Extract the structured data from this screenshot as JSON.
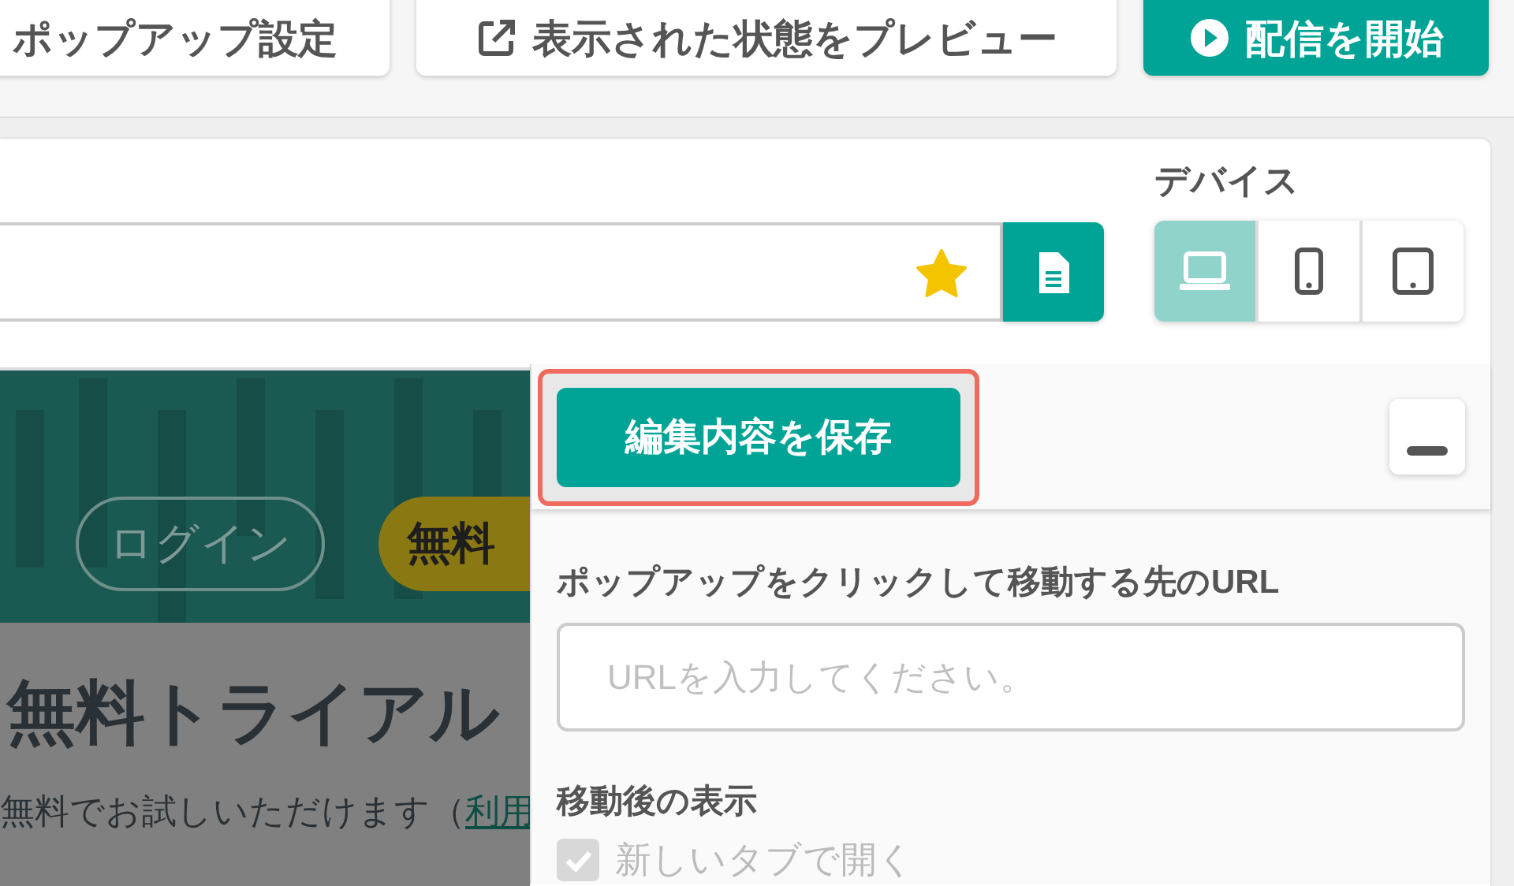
{
  "toolbar": {
    "buttons": [
      {
        "label": "ポップアップ設定",
        "kind": "plain"
      },
      {
        "label": "表示された状態をプレビュー",
        "kind": "preview"
      },
      {
        "label": "配信を開始",
        "kind": "primary"
      }
    ]
  },
  "url_bar": {
    "starred": true
  },
  "devices": {
    "label": "デバイス",
    "items": [
      {
        "kind": "laptop",
        "selected": true
      },
      {
        "kind": "phone",
        "selected": false
      },
      {
        "kind": "tablet",
        "selected": false
      }
    ]
  },
  "preview": {
    "login_button": "ログイン",
    "trial_button": "無料",
    "heading": "無料トライアル",
    "text": "無料でお試しいただけます（",
    "link": "利用"
  },
  "editor": {
    "save_button": "編集内容を保存",
    "save_highlighted": true,
    "url_label": "ポップアップをクリックして移動する先のURL",
    "url_placeholder": "URLを入力してください。",
    "after_label": "移動後の表示",
    "new_tab": {
      "label": "新しいタブで開く",
      "checked": true,
      "disabled": true
    }
  }
}
